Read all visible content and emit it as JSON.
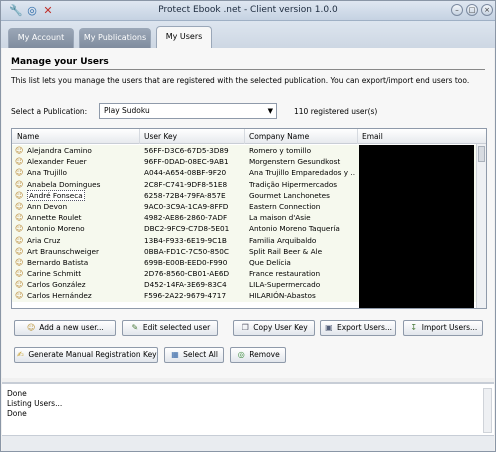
{
  "window": {
    "title": "Protect Ebook .net - Client version 1.0.0"
  },
  "titlebar_icons": [
    "wrench-icon",
    "search-icon",
    "close-x-icon"
  ],
  "tabs": [
    {
      "label": "My Account",
      "active": false
    },
    {
      "label": "My Publications",
      "active": false
    },
    {
      "label": "My Users",
      "active": true
    }
  ],
  "panel": {
    "heading": "Manage your Users",
    "description": "This list lets you manage the users that are registered with the selected publication. You can export/import end users too.",
    "publication_label": "Select a Publication:",
    "publication_value": "Play Sudoku",
    "registered_count": "110 registered user(s)"
  },
  "table": {
    "columns": [
      "Name",
      "User Key",
      "Company Name",
      "Email"
    ],
    "selected_row": 5,
    "rows": [
      [
        "Alejandra Camino",
        "56FF-D3C6-67D5-3D89",
        "Romero y tomillo"
      ],
      [
        "Alexander Feuer",
        "96FF-0DAD-08EC-9AB1",
        "Morgenstern Gesundkost"
      ],
      [
        "Ana Trujillo",
        "A044-A654-08BF-9F20",
        "Ana Trujillo Emparedados y ..."
      ],
      [
        "Anabela Domingues",
        "2C8F-C741-9DF8-51E8",
        "Tradição Hipermercados"
      ],
      [
        "André Fonseca",
        "6258-72B4-79FA-857E",
        "Gourmet Lanchonetes"
      ],
      [
        "Ann Devon",
        "9AC0-3C9A-1CA9-8FFD",
        "Eastern Connection"
      ],
      [
        "Annette Roulet",
        "4982-AE86-2860-7ADF",
        "La maison d'Asie"
      ],
      [
        "Antonio Moreno",
        "DBC2-9FC9-C7D8-5E01",
        "Antonio Moreno Taquería"
      ],
      [
        "Aria Cruz",
        "13B4-F933-6E19-9C1B",
        "Familia Arquibaldo"
      ],
      [
        "Art Braunschweiger",
        "0BBA-FD1C-7C50-850C",
        "Split Rail Beer & Ale"
      ],
      [
        "Bernardo Batista",
        "699B-E00B-EED0-F990",
        "Que Delícia"
      ],
      [
        "Carine Schmitt",
        "2D76-8560-CB01-AE6D",
        "France restauration"
      ],
      [
        "Carlos González",
        "D452-14FA-3E69-83C4",
        "LILA-Supermercado"
      ],
      [
        "Carlos Hernández",
        "F596-2A22-9679-4717",
        "HILARIÓN-Abastos"
      ]
    ]
  },
  "buttons": {
    "add": "Add a new user...",
    "edit": "Edit selected user",
    "copy": "Copy User Key",
    "export": "Export Users...",
    "import": "Import Users...",
    "generate": "Generate Manual Registration Key",
    "select_all": "Select All",
    "remove": "Remove"
  },
  "log": [
    "Done",
    "Listing Users...",
    "Done"
  ]
}
